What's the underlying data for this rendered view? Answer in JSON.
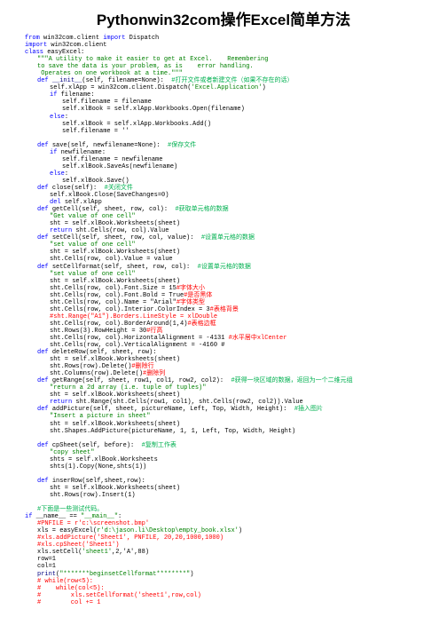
{
  "title": "Pythonwin32com操作Excel简单方法",
  "lines": [
    {
      "i": 0,
      "segs": [
        {
          "c": "kw",
          "t": "from "
        },
        {
          "c": "blk",
          "t": "win32com.client "
        },
        {
          "c": "kw",
          "t": "import "
        },
        {
          "c": "blk",
          "t": "Dispatch"
        }
      ]
    },
    {
      "i": 0,
      "segs": [
        {
          "c": "kw",
          "t": "import "
        },
        {
          "c": "blk",
          "t": "win32com.client"
        }
      ]
    },
    {
      "i": 0,
      "segs": [
        {
          "c": "kw",
          "t": "class "
        },
        {
          "c": "blk",
          "t": "easyExcel:"
        }
      ]
    },
    {
      "i": 1,
      "segs": [
        {
          "c": "str",
          "t": "\"\"\"A utility to make it easier to get at Excel.    Remembering"
        }
      ]
    },
    {
      "i": 1,
      "segs": [
        {
          "c": "str",
          "t": "to save the data is your problem, as is    error handling."
        }
      ]
    },
    {
      "i": 1,
      "segs": [
        {
          "c": "str",
          "t": " Operates on one workbook at a time.\"\"\""
        }
      ]
    },
    {
      "i": 1,
      "segs": [
        {
          "c": "kw",
          "t": "def "
        },
        {
          "c": "bi",
          "t": "__init__"
        },
        {
          "c": "blk",
          "t": "(self, filename=None):  "
        },
        {
          "c": "grn",
          "t": "#打开文件或者新建文件（如果不存在的话）"
        }
      ]
    },
    {
      "i": 2,
      "segs": [
        {
          "c": "blk",
          "t": "self.xlApp = win32com.client.Dispatch("
        },
        {
          "c": "str",
          "t": "'Excel.Application'"
        },
        {
          "c": "blk",
          "t": ")"
        }
      ]
    },
    {
      "i": 2,
      "segs": [
        {
          "c": "kw",
          "t": "if "
        },
        {
          "c": "blk",
          "t": "filename:"
        }
      ]
    },
    {
      "i": 3,
      "segs": [
        {
          "c": "blk",
          "t": "self.filename = filename"
        }
      ]
    },
    {
      "i": 3,
      "segs": [
        {
          "c": "blk",
          "t": "self.xlBook = self.xlApp.Workbooks.Open(filename)"
        }
      ]
    },
    {
      "i": 2,
      "segs": [
        {
          "c": "kw",
          "t": "else"
        },
        {
          "c": "blk",
          "t": ":"
        }
      ]
    },
    {
      "i": 3,
      "segs": [
        {
          "c": "blk",
          "t": "self.xlBook = self.xlApp.Workbooks.Add()"
        }
      ]
    },
    {
      "i": 3,
      "segs": [
        {
          "c": "blk",
          "t": "self.filename = ''"
        }
      ]
    },
    {
      "i": 0,
      "segs": [
        {
          "c": "blk",
          "t": " "
        }
      ]
    },
    {
      "i": 1,
      "segs": [
        {
          "c": "kw",
          "t": "def "
        },
        {
          "c": "blk",
          "t": "save(self, newfilename=None):  "
        },
        {
          "c": "grn",
          "t": "#保存文件"
        }
      ]
    },
    {
      "i": 2,
      "segs": [
        {
          "c": "kw",
          "t": "if "
        },
        {
          "c": "blk",
          "t": "newfilename:"
        }
      ]
    },
    {
      "i": 3,
      "segs": [
        {
          "c": "blk",
          "t": "self.filename = newfilename"
        }
      ]
    },
    {
      "i": 3,
      "segs": [
        {
          "c": "blk",
          "t": "self.xlBook.SaveAs(newfilename)"
        }
      ]
    },
    {
      "i": 2,
      "segs": [
        {
          "c": "kw",
          "t": "else"
        },
        {
          "c": "blk",
          "t": ":"
        }
      ]
    },
    {
      "i": 3,
      "segs": [
        {
          "c": "blk",
          "t": "self.xlBook.Save()"
        }
      ]
    },
    {
      "i": 1,
      "segs": [
        {
          "c": "kw",
          "t": "def "
        },
        {
          "c": "blk",
          "t": "close(self):  "
        },
        {
          "c": "grn",
          "t": "#关闭文件"
        }
      ]
    },
    {
      "i": 2,
      "segs": [
        {
          "c": "blk",
          "t": "self.xlBook.Close(SaveChanges=0)"
        }
      ]
    },
    {
      "i": 2,
      "segs": [
        {
          "c": "kw",
          "t": "del "
        },
        {
          "c": "blk",
          "t": "self.xlApp"
        }
      ]
    },
    {
      "i": 1,
      "segs": [
        {
          "c": "kw",
          "t": "def "
        },
        {
          "c": "blk",
          "t": "getCell(self, sheet, row, col):  "
        },
        {
          "c": "grn",
          "t": "#获取单元格的数据"
        }
      ]
    },
    {
      "i": 2,
      "segs": [
        {
          "c": "str",
          "t": "\"Get value of one cell\""
        }
      ]
    },
    {
      "i": 2,
      "segs": [
        {
          "c": "blk",
          "t": "sht = self.xlBook.Worksheets(sheet)"
        }
      ]
    },
    {
      "i": 2,
      "segs": [
        {
          "c": "kw",
          "t": "return "
        },
        {
          "c": "blk",
          "t": "sht.Cells(row, col).Value"
        }
      ]
    },
    {
      "i": 1,
      "segs": [
        {
          "c": "kw",
          "t": "def "
        },
        {
          "c": "blk",
          "t": "setCell(self, sheet, row, col, value):  "
        },
        {
          "c": "grn",
          "t": "#设置单元格的数据"
        }
      ]
    },
    {
      "i": 2,
      "segs": [
        {
          "c": "str",
          "t": "\"set value of one cell\""
        }
      ]
    },
    {
      "i": 2,
      "segs": [
        {
          "c": "blk",
          "t": "sht = self.xlBook.Worksheets(sheet)"
        }
      ]
    },
    {
      "i": 2,
      "segs": [
        {
          "c": "blk",
          "t": "sht.Cells(row, col).Value = value"
        }
      ]
    },
    {
      "i": 1,
      "segs": [
        {
          "c": "kw",
          "t": "def "
        },
        {
          "c": "blk",
          "t": "setCellformat(self, sheet, row, col):  "
        },
        {
          "c": "grn",
          "t": "#设置单元格的数据"
        }
      ]
    },
    {
      "i": 2,
      "segs": [
        {
          "c": "str",
          "t": "\"set value of one cell\""
        }
      ]
    },
    {
      "i": 2,
      "segs": [
        {
          "c": "blk",
          "t": "sht = self.xlBook.Worksheets(sheet)"
        }
      ]
    },
    {
      "i": 2,
      "segs": [
        {
          "c": "blk",
          "t": "sht.Cells(row, col).Font.Size = 15"
        },
        {
          "c": "red",
          "t": "#字体大小"
        }
      ]
    },
    {
      "i": 2,
      "segs": [
        {
          "c": "blk",
          "t": "sht.Cells(row, col).Font.Bold = True"
        },
        {
          "c": "red",
          "t": "#是否黑体"
        }
      ]
    },
    {
      "i": 2,
      "segs": [
        {
          "c": "blk",
          "t": "sht.Cells(row, col).Name = \"Arial\""
        },
        {
          "c": "red",
          "t": "#字体类型"
        }
      ]
    },
    {
      "i": 2,
      "segs": [
        {
          "c": "blk",
          "t": "sht.Cells(row, col).Interior.ColorIndex = 3"
        },
        {
          "c": "red",
          "t": "#表格背景"
        }
      ]
    },
    {
      "i": 2,
      "segs": [
        {
          "c": "red",
          "t": "#sht.Range(\"A1\").Borders.LineStyle = xlDouble"
        }
      ]
    },
    {
      "i": 2,
      "segs": [
        {
          "c": "blk",
          "t": "sht.Cells(row, col).BorderAround(1,4)"
        },
        {
          "c": "red",
          "t": "#表格边框"
        }
      ]
    },
    {
      "i": 2,
      "segs": [
        {
          "c": "blk",
          "t": "sht.Rows(3).RowHeight = 30"
        },
        {
          "c": "red",
          "t": "#行高"
        }
      ]
    },
    {
      "i": 2,
      "segs": [
        {
          "c": "blk",
          "t": "sht.Cells(row, col).HorizontalAlignment = -4131 "
        },
        {
          "c": "red",
          "t": "#水平居中xlCenter"
        }
      ]
    },
    {
      "i": 2,
      "segs": [
        {
          "c": "blk",
          "t": "sht.Cells(row, col).VerticalAlignment = -4160 #"
        }
      ]
    },
    {
      "i": 1,
      "segs": [
        {
          "c": "kw",
          "t": "def "
        },
        {
          "c": "blk",
          "t": "deleteRow(self, sheet, row):"
        }
      ]
    },
    {
      "i": 2,
      "segs": [
        {
          "c": "blk",
          "t": "sht = self.xlBook.Worksheets(sheet)"
        }
      ]
    },
    {
      "i": 2,
      "segs": [
        {
          "c": "blk",
          "t": "sht.Rows(row).Delete()"
        },
        {
          "c": "red",
          "t": "#删除行"
        }
      ]
    },
    {
      "i": 2,
      "segs": [
        {
          "c": "blk",
          "t": "sht.Columns(row).Delete()"
        },
        {
          "c": "red",
          "t": "#删除列"
        }
      ]
    },
    {
      "i": 1,
      "segs": [
        {
          "c": "kw",
          "t": "def "
        },
        {
          "c": "blk",
          "t": "getRange(self, sheet, row1, col1, row2, col2):  "
        },
        {
          "c": "grn",
          "t": "#获得一块区域的数据，返回为一个二维元组"
        }
      ]
    },
    {
      "i": 2,
      "segs": [
        {
          "c": "str",
          "t": "\"return a 2d array (i.e. tuple of tuples)\""
        }
      ]
    },
    {
      "i": 2,
      "segs": [
        {
          "c": "blk",
          "t": "sht = self.xlBook.Worksheets(sheet)"
        }
      ]
    },
    {
      "i": 2,
      "segs": [
        {
          "c": "kw",
          "t": "return "
        },
        {
          "c": "blk",
          "t": "sht.Range(sht.Cells(row1, col1), sht.Cells(row2, col2)).Value"
        }
      ]
    },
    {
      "i": 1,
      "segs": [
        {
          "c": "kw",
          "t": "def "
        },
        {
          "c": "blk",
          "t": "addPicture(self, sheet, pictureName, Left, Top, Width, Height):  "
        },
        {
          "c": "grn",
          "t": "#插入图片"
        }
      ]
    },
    {
      "i": 2,
      "segs": [
        {
          "c": "str",
          "t": "\"Insert a picture in sheet\""
        }
      ]
    },
    {
      "i": 2,
      "segs": [
        {
          "c": "blk",
          "t": "sht = self.xlBook.Worksheets(sheet)"
        }
      ]
    },
    {
      "i": 2,
      "segs": [
        {
          "c": "blk",
          "t": "sht.Shapes.AddPicture(pictureName, 1, 1, Left, Top, Width, Height)"
        }
      ]
    },
    {
      "i": 0,
      "segs": [
        {
          "c": "blk",
          "t": " "
        }
      ]
    },
    {
      "i": 1,
      "segs": [
        {
          "c": "kw",
          "t": "def "
        },
        {
          "c": "blk",
          "t": "cpSheet(self, before):  "
        },
        {
          "c": "grn",
          "t": "#复制工作表"
        }
      ]
    },
    {
      "i": 2,
      "segs": [
        {
          "c": "str",
          "t": "\"copy sheet\""
        }
      ]
    },
    {
      "i": 2,
      "segs": [
        {
          "c": "blk",
          "t": "shts = self.xlBook.Worksheets"
        }
      ]
    },
    {
      "i": 2,
      "segs": [
        {
          "c": "blk",
          "t": "shts(1).Copy(None,shts(1))"
        }
      ]
    },
    {
      "i": 0,
      "segs": [
        {
          "c": "blk",
          "t": " "
        }
      ]
    },
    {
      "i": 1,
      "segs": [
        {
          "c": "kw",
          "t": "def "
        },
        {
          "c": "blk",
          "t": "inserRow(self,sheet,row):"
        }
      ]
    },
    {
      "i": 2,
      "segs": [
        {
          "c": "blk",
          "t": "sht = self.xlBook.Worksheets(sheet)"
        }
      ]
    },
    {
      "i": 2,
      "segs": [
        {
          "c": "blk",
          "t": "sht.Rows(row).Insert(1)"
        }
      ]
    },
    {
      "i": 0,
      "segs": [
        {
          "c": "blk",
          "t": " "
        }
      ]
    },
    {
      "i": 1,
      "segs": [
        {
          "c": "grn",
          "t": "#下面是一些测试代码。"
        }
      ]
    },
    {
      "i": 0,
      "segs": [
        {
          "c": "kw",
          "t": "if "
        },
        {
          "c": "blk",
          "t": "__name__ == "
        },
        {
          "c": "str",
          "t": "\"__main__\""
        },
        {
          "c": "blk",
          "t": ":"
        }
      ]
    },
    {
      "i": 1,
      "segs": [
        {
          "c": "red",
          "t": "#PNFILE = r'c:\\screenshot.bmp'"
        }
      ]
    },
    {
      "i": 1,
      "segs": [
        {
          "c": "blk",
          "t": "xls = easyExcel("
        },
        {
          "c": "str",
          "t": "r'd:\\jason.li\\Desktop\\empty_book.xlsx'"
        },
        {
          "c": "blk",
          "t": ")"
        }
      ]
    },
    {
      "i": 1,
      "segs": [
        {
          "c": "red",
          "t": "#xls.addPicture('Sheet1', PNFILE, 20,20,1000,1000)"
        }
      ]
    },
    {
      "i": 1,
      "segs": [
        {
          "c": "red",
          "t": "#xls.cpSheet('Sheet1')"
        }
      ]
    },
    {
      "i": 1,
      "segs": [
        {
          "c": "blk",
          "t": "xls.setCell("
        },
        {
          "c": "str",
          "t": "'sheet1'"
        },
        {
          "c": "blk",
          "t": ",2,'A',88)"
        }
      ]
    },
    {
      "i": 1,
      "segs": [
        {
          "c": "blk",
          "t": "row=1"
        }
      ]
    },
    {
      "i": 1,
      "segs": [
        {
          "c": "blk",
          "t": "col=1"
        }
      ]
    },
    {
      "i": 1,
      "segs": [
        {
          "c": "bi",
          "t": "print"
        },
        {
          "c": "blk",
          "t": "("
        },
        {
          "c": "str",
          "t": "\"*******beginsetCellformat********\""
        },
        {
          "c": "blk",
          "t": ")"
        }
      ]
    },
    {
      "i": 1,
      "segs": [
        {
          "c": "red",
          "t": "# while(row<5):"
        }
      ]
    },
    {
      "i": 1,
      "segs": [
        {
          "c": "red",
          "t": "#    while(col<5):"
        }
      ]
    },
    {
      "i": 1,
      "segs": [
        {
          "c": "red",
          "t": "#        xls.setCellformat('sheet1',row,col)"
        }
      ]
    },
    {
      "i": 1,
      "segs": [
        {
          "c": "red",
          "t": "#        col += 1"
        }
      ]
    }
  ]
}
